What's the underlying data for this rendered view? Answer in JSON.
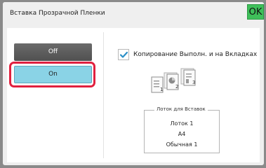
{
  "header": {
    "title": "Вставка Прозрачной Пленки",
    "ok_label": "OK"
  },
  "mode": {
    "off_label": "Off",
    "on_label": "On",
    "selected": "On"
  },
  "option": {
    "checkbox_label": "Копирование Выполн. и на Вкладках",
    "checked": true
  },
  "illustration": {
    "page_numbers": [
      "1",
      "2",
      "3"
    ]
  },
  "tray": {
    "legend": "Лоток для Вставок",
    "tray_name": "Лоток 1",
    "paper_size": "A4",
    "paper_type": "Обычная 1"
  },
  "colors": {
    "ok_green": "#3fbf5a",
    "selected_blue": "#8ad3e6",
    "highlight_red": "#e0213f",
    "check_blue": "#2b8fc6"
  }
}
